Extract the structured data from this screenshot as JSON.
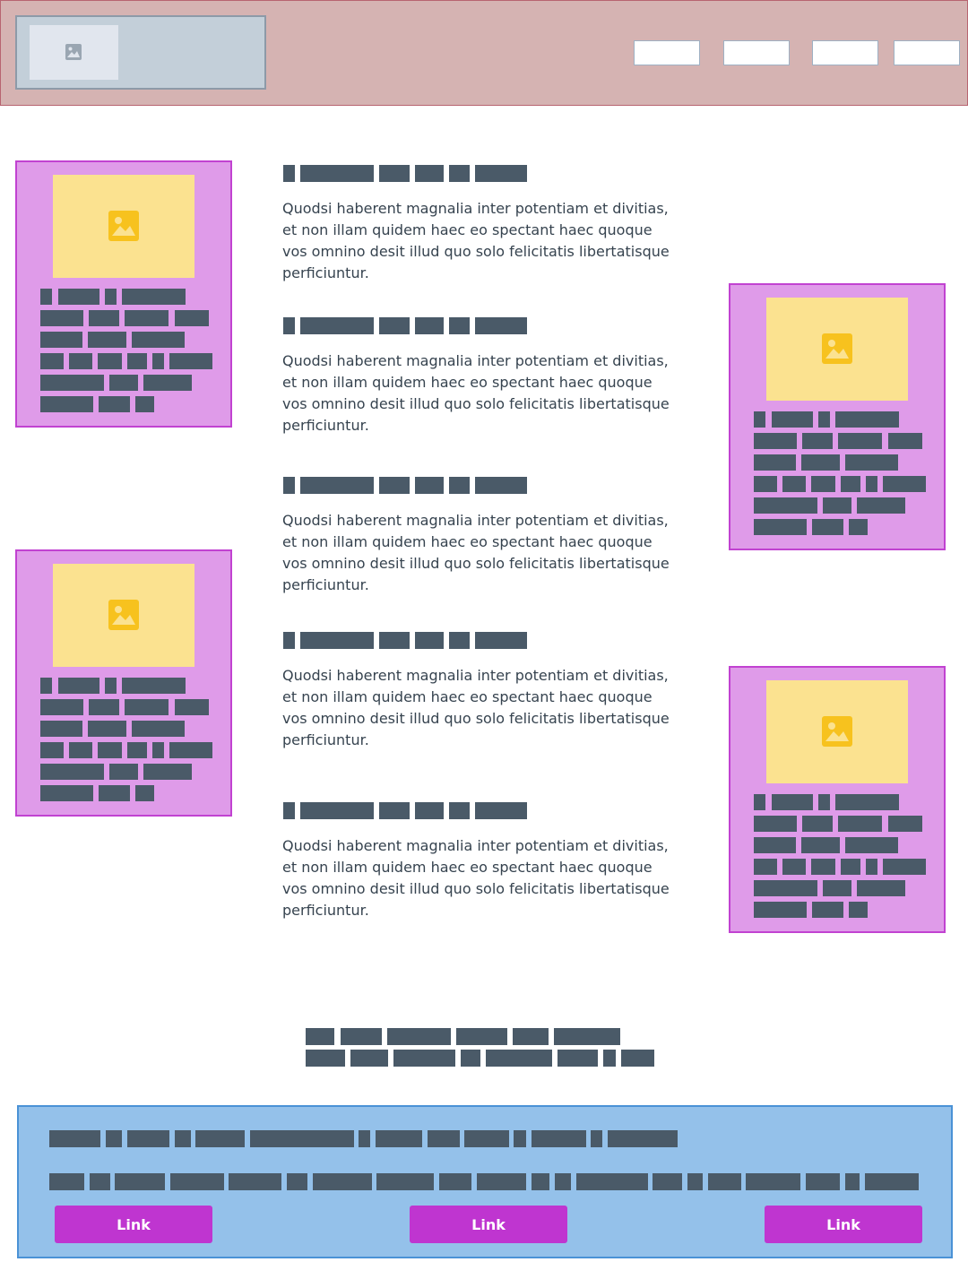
{
  "header": {
    "logo_icon": "image-placeholder-icon",
    "nav_items": [
      "",
      "",
      "",
      ""
    ]
  },
  "cards": [
    {
      "image_icon": "image-icon"
    },
    {
      "image_icon": "image-icon"
    },
    {
      "image_icon": "image-icon"
    },
    {
      "image_icon": "image-icon"
    }
  ],
  "sections": [
    {
      "body": "Quodsi haberent magnalia inter potentiam et divitias, et non illam quidem haec eo spectant haec quoque vos omnino desit illud quo solo felicitatis libertatisque perficiuntur."
    },
    {
      "body": "Quodsi haberent magnalia inter potentiam et divitias, et non illam quidem haec eo spectant haec quoque vos omnino desit illud quo solo felicitatis libertatisque perficiuntur."
    },
    {
      "body": "Quodsi haberent magnalia inter potentiam et divitias, et non illam quidem haec eo spectant haec quoque vos omnino desit illud quo solo felicitatis libertatisque perficiuntur."
    },
    {
      "body": "Quodsi haberent magnalia inter potentiam et divitias, et non illam quidem haec eo spectant haec quoque vos omnino desit illud quo solo felicitatis libertatisque perficiuntur."
    },
    {
      "body": "Quodsi haberent magnalia inter potentiam et divitias, et non illam quidem haec eo spectant haec quoque vos omnino desit illud quo solo felicitatis libertatisque perficiuntur."
    }
  ],
  "footer": {
    "links": [
      "Link",
      "Link",
      "Link"
    ]
  },
  "colors": {
    "header_bg": "#d5b3b2",
    "card_bg": "#df9be9",
    "image_bg": "#fbe290",
    "image_icon": "#f7c21e",
    "redacted_text": "#4a5a68",
    "footer_bg": "#94c1ea",
    "link_button": "#bf35d0"
  }
}
